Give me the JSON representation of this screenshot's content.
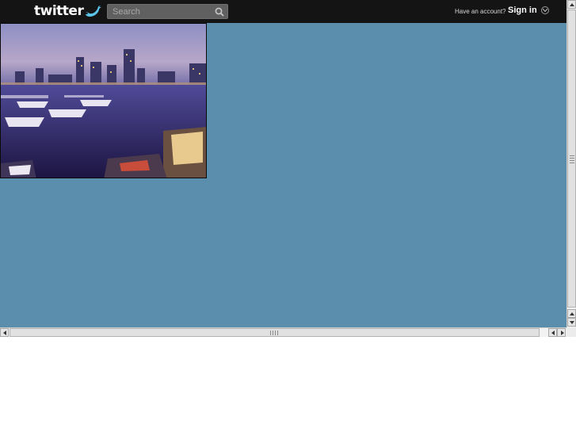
{
  "header": {
    "logo_text": "twitter",
    "search_placeholder": "Search",
    "account_prompt": "Have an account?",
    "signin_label": "Sign in"
  },
  "colors": {
    "topbar": "#141414",
    "page_background": "#5b8dac",
    "search_box": "#606060"
  },
  "content": {
    "photo_subject": "harbor city skyline at dusk with boats"
  },
  "icons": {
    "search": "search-icon",
    "signin_menu": "chevron-down-icon",
    "logo_bird": "bird-icon"
  }
}
